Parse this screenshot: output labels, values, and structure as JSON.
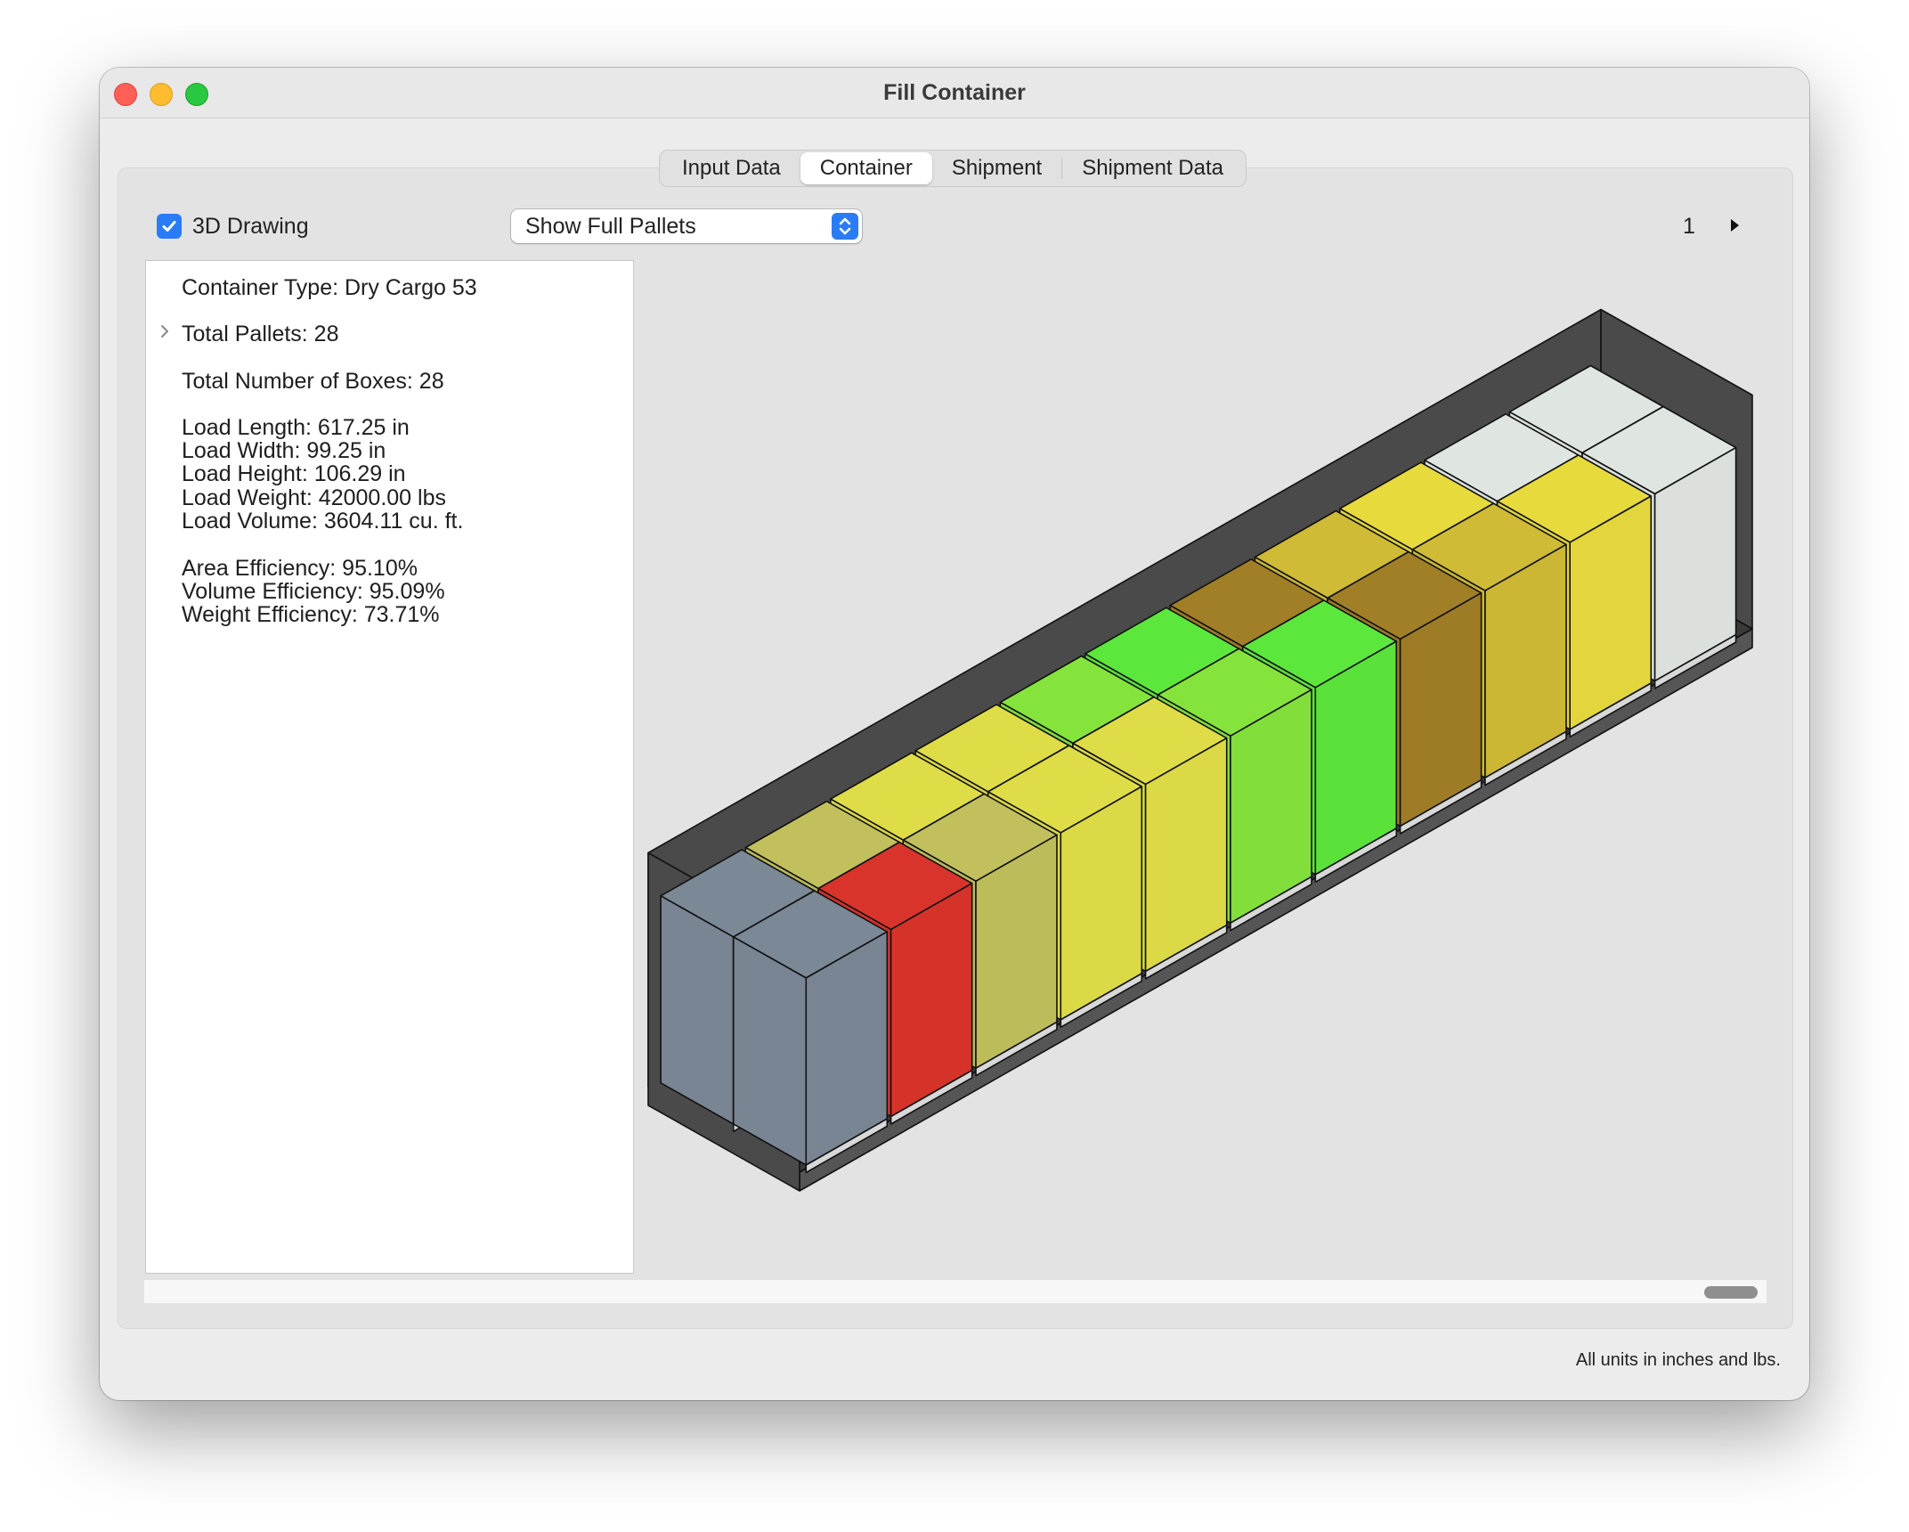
{
  "window": {
    "title": "Fill Container"
  },
  "tabs": [
    {
      "label": "Input Data",
      "active": false
    },
    {
      "label": "Container",
      "active": true
    },
    {
      "label": "Shipment",
      "active": false
    },
    {
      "label": "Shipment Data",
      "active": false
    }
  ],
  "toolbar": {
    "drawing_checkbox_label": "3D Drawing",
    "drawing_checked": true,
    "display_mode": "Show Full Pallets",
    "page_number": "1"
  },
  "info": {
    "container_type": "Container Type: Dry Cargo 53",
    "total_pallets": "Total Pallets: 28",
    "total_boxes": "Total Number of Boxes: 28",
    "load_length": "Load Length: 617.25 in",
    "load_width": "Load Width: 99.25 in",
    "load_height": "Load Height: 106.29 in",
    "load_weight": "Load Weight: 42000.00 lbs",
    "load_volume": "Load Volume: 3604.11 cu. ft.",
    "area_efficiency": "Area Efficiency: 95.10%",
    "volume_efficiency": "Volume Efficiency: 95.09%",
    "weight_efficiency": "Weight Efficiency: 73.71%"
  },
  "footer": {
    "units_note": "All units in inches and lbs."
  },
  "colors": {
    "accent": "#2a7cf6",
    "container_wall": "#4a4a4a",
    "box_slate": "#7b8896",
    "box_red": "#d9342b",
    "box_olive": "#c1c05d",
    "box_yellow": "#dfdd47",
    "box_lime": "#85e43c",
    "box_green": "#5ce73c",
    "box_brown": "#a17f27",
    "box_gold": "#cfbb35",
    "box_bright_yellow": "#e7da3d",
    "box_light_gray": "#dfe5e1"
  }
}
